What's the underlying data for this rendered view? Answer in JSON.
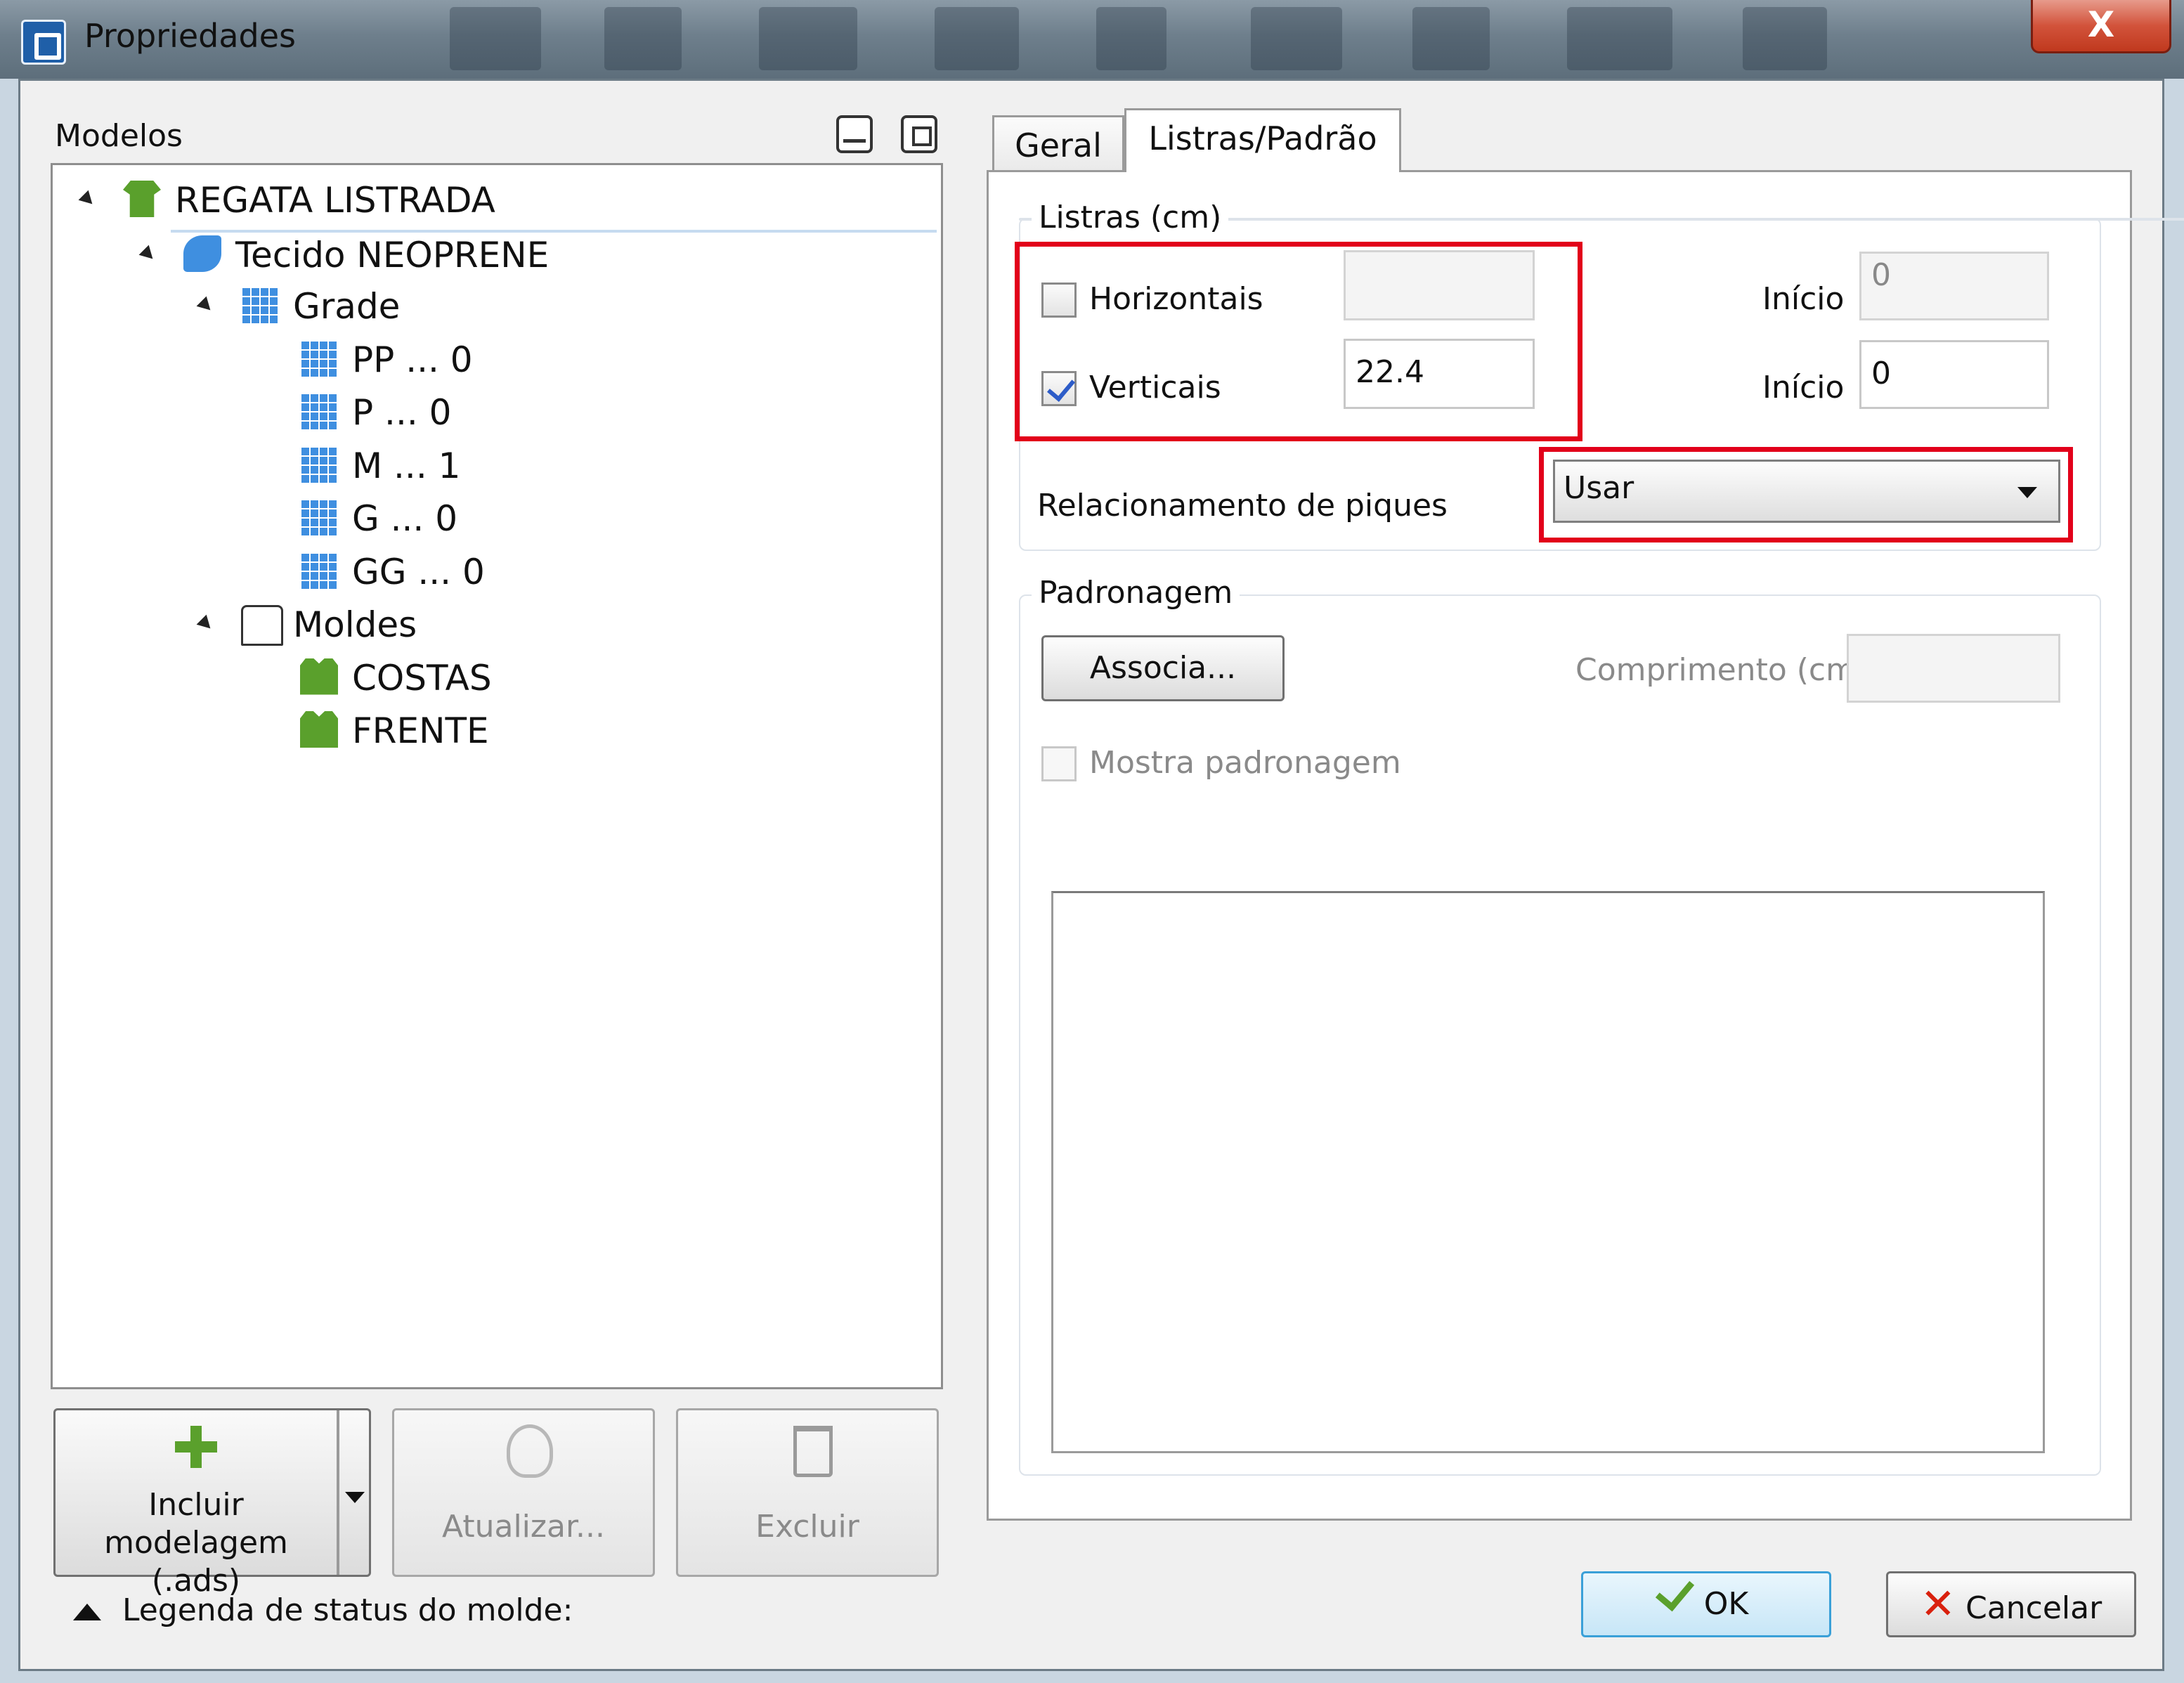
{
  "window": {
    "title": "Propriedades",
    "close_glyph": "X"
  },
  "left": {
    "models_label": "Modelos",
    "tree": [
      {
        "label": "REGATA LISTRADA",
        "icon": "shirt-icon",
        "expanded": true
      },
      {
        "label": "Tecido NEOPRENE",
        "icon": "fabric-icon",
        "expanded": true,
        "selected": true
      },
      {
        "label": "Grade",
        "icon": "grid-icon",
        "expanded": true
      },
      {
        "label": "PP ... 0",
        "icon": "size-grid-icon"
      },
      {
        "label": "P ... 0",
        "icon": "size-grid-icon"
      },
      {
        "label": "M ... 1",
        "icon": "size-grid-icon"
      },
      {
        "label": "G ... 0",
        "icon": "size-grid-icon"
      },
      {
        "label": "GG ... 0",
        "icon": "size-grid-icon"
      },
      {
        "label": "Moldes",
        "icon": "pattern-icon",
        "expanded": true
      },
      {
        "label": "COSTAS",
        "icon": "check-piece-icon"
      },
      {
        "label": "FRENTE",
        "icon": "check-piece-icon"
      }
    ],
    "buttons": {
      "include_line1": "Incluir modelagem",
      "include_line2": "(.ads)",
      "update": "Atualizar...",
      "delete": "Excluir"
    },
    "legend": "Legenda de status do molde:"
  },
  "tabs": [
    {
      "label": "Geral"
    },
    {
      "label": "Listras/Padrão",
      "active": true
    }
  ],
  "stripes": {
    "group_title": "Listras (cm)",
    "horizontal": {
      "label": "Horizontais",
      "checked": false,
      "value": "",
      "start_label": "Início",
      "start_value": "0"
    },
    "vertical": {
      "label": "Verticais",
      "checked": true,
      "value": "22.4",
      "start_label": "Início",
      "start_value": "0"
    },
    "notch_label": "Relacionamento de piques",
    "notch_value": "Usar"
  },
  "pattern": {
    "group_title": "Padronagem",
    "associate_button": "Associa...",
    "length_label": "Comprimento (cm)",
    "length_value": "",
    "show_label": "Mostra padronagem"
  },
  "footer": {
    "ok": "OK",
    "cancel": "Cancelar"
  },
  "colors": {
    "highlight": "#e2001a",
    "accent_green": "#5aa02c",
    "selection": "#dceaf7"
  }
}
